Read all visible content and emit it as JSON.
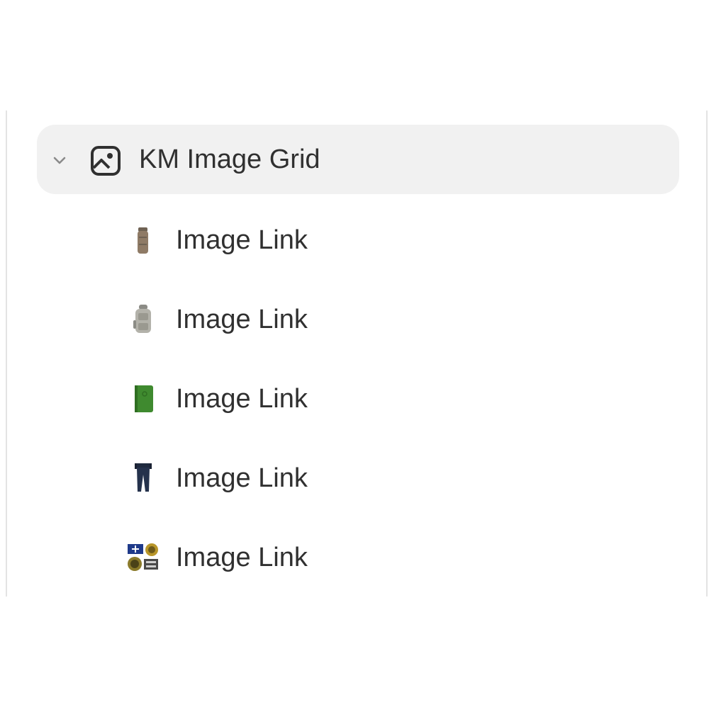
{
  "section": {
    "title": "KM Image Grid",
    "icon": "image-section-icon",
    "expanded": true,
    "chevron_icon": "chevron-down-icon"
  },
  "blocks": [
    {
      "label": "Image Link",
      "thumbnail": "tan-pouch-thumbnail"
    },
    {
      "label": "Image Link",
      "thumbnail": "gray-backpack-thumbnail"
    },
    {
      "label": "Image Link",
      "thumbnail": "green-notebook-thumbnail"
    },
    {
      "label": "Image Link",
      "thumbnail": "navy-pants-thumbnail"
    },
    {
      "label": "Image Link",
      "thumbnail": "patches-thumbnail"
    }
  ]
}
